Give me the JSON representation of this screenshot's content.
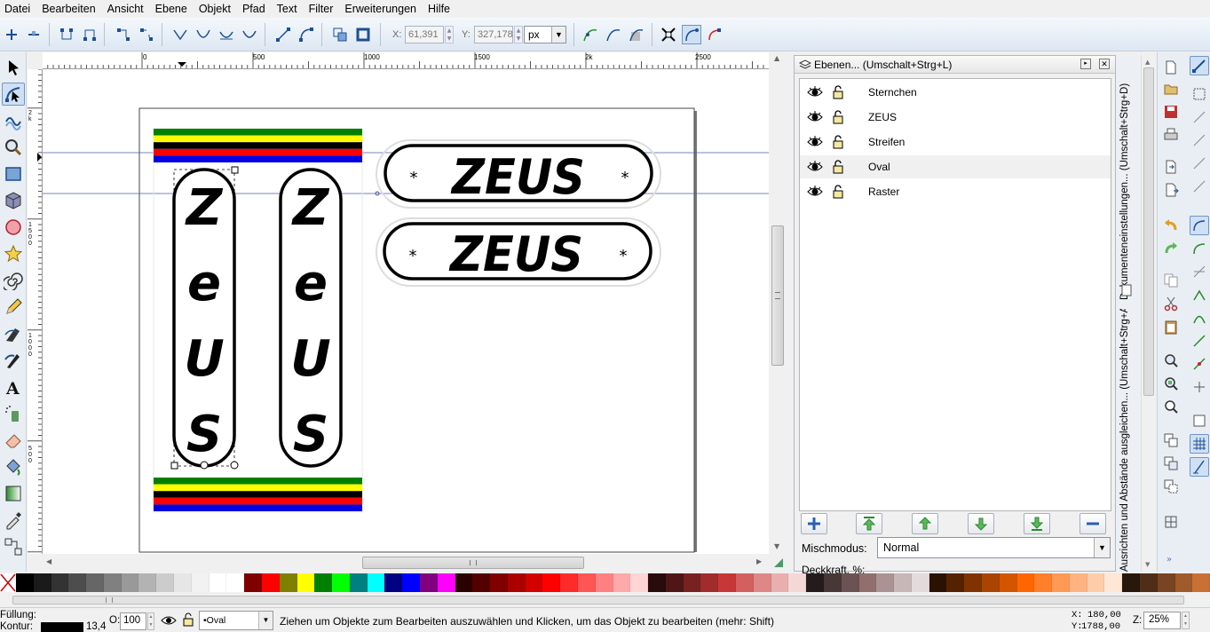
{
  "menu": [
    "Datei",
    "Bearbeiten",
    "Ansicht",
    "Ebene",
    "Objekt",
    "Pfad",
    "Text",
    "Filter",
    "Erweiterungen",
    "Hilfe"
  ],
  "toolctrl": {
    "x_label": "X:",
    "x_value": "61,391",
    "y_label": "Y:",
    "y_value": "327,178",
    "unit": "px"
  },
  "ruler": {
    "h_labels": [
      "0",
      "500",
      "1000",
      "1500",
      "2k",
      "2500"
    ],
    "v_labels": [
      "2k",
      "1500",
      "1000",
      "500"
    ]
  },
  "canvas": {
    "vertical_text": [
      "Z",
      "e",
      "U",
      "S"
    ],
    "horizontal_text": "ZEUS",
    "star": "*",
    "stripe_colors": [
      "#008000",
      "#ffff00",
      "#000000",
      "#ff0000",
      "#0000e0"
    ]
  },
  "layers_panel": {
    "title": "Ebenen... (Umschalt+Strg+L)",
    "layers": [
      {
        "name": "Sternchen",
        "selected": false
      },
      {
        "name": "ZEUS",
        "selected": false
      },
      {
        "name": "Streifen",
        "selected": false
      },
      {
        "name": "Oval",
        "selected": true
      },
      {
        "name": "Raster",
        "selected": false
      }
    ],
    "blend_label": "Mischmodus:",
    "blend_value": "Normal",
    "opacity_label": "Deckkraft, %:"
  },
  "side_tabs": [
    "Dokumenteneinstellungen... (Umschalt+Strg+D)",
    "Ausrichten und Abstände ausgleichen... (Umschalt+Strg+A)"
  ],
  "palette": [
    "#000000",
    "#1a1a1a",
    "#333333",
    "#4d4d4d",
    "#666666",
    "#808080",
    "#999999",
    "#b3b3b3",
    "#cccccc",
    "#e6e6e6",
    "#f2f2f2",
    "#ffffff",
    "#ffffff",
    "#800000",
    "#ff0000",
    "#808000",
    "#ffff00",
    "#008000",
    "#00ff00",
    "#008080",
    "#00ffff",
    "#000080",
    "#0000ff",
    "#800080",
    "#ff00ff",
    "#2b0000",
    "#550000",
    "#800000",
    "#aa0000",
    "#d40000",
    "#ff0000",
    "#ff2a2a",
    "#ff5555",
    "#ff8080",
    "#ffaaaa",
    "#ffd5d5",
    "#280b0b",
    "#501616",
    "#782121",
    "#a02c2c",
    "#c83737",
    "#d35f5f",
    "#de8787",
    "#e9afaf",
    "#f4d7d7",
    "#241c1c",
    "#483737",
    "#6c5353",
    "#916f6f",
    "#ac9393",
    "#c8b7b7",
    "#e3dbdb",
    "#2b1100",
    "#552200",
    "#803300",
    "#aa4400",
    "#d45500",
    "#ff6600",
    "#ff7f2a",
    "#ff9955",
    "#ffb380",
    "#ffccaa",
    "#ffe6d5",
    "#28170b",
    "#502d16",
    "#784421",
    "#a05a2c",
    "#c87137"
  ],
  "status": {
    "fill_label": "Füllung:",
    "stroke_label": "Kontur:",
    "stroke_width": "13,4",
    "opacity_label": "O:",
    "opacity_value": "100",
    "layer_value": "•Oval",
    "message": "Ziehen um Objekte zum Bearbeiten auszuwählen und Klicken, um das Objekt zu bearbeiten (mehr: Shift)",
    "cursor_x_label": "X:",
    "cursor_x": "180,00",
    "cursor_y_label": "Y:",
    "cursor_y": "1788,00",
    "zoom_label": "Z:",
    "zoom_value": "25%"
  }
}
